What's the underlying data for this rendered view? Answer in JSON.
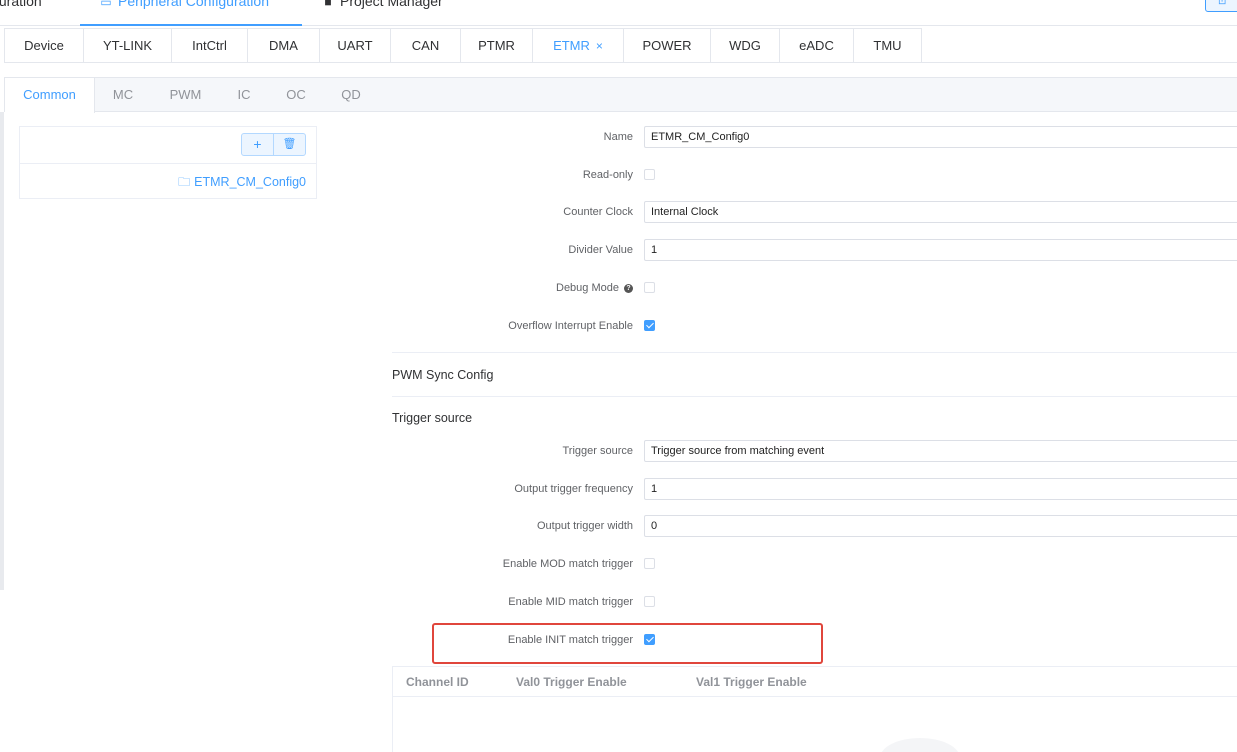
{
  "top_nav": {
    "tabs": [
      {
        "label": "iguration",
        "icon": ""
      },
      {
        "label": "Peripheral Configuration",
        "icon": "monitor-icon"
      },
      {
        "label": "Project Manager",
        "icon": "document-icon"
      }
    ],
    "active_tab": "Peripheral Configuration"
  },
  "peripheral_tabs": [
    {
      "label": "Device"
    },
    {
      "label": "YT-LINK"
    },
    {
      "label": "IntCtrl"
    },
    {
      "label": "DMA"
    },
    {
      "label": "UART"
    },
    {
      "label": "CAN"
    },
    {
      "label": "PTMR"
    },
    {
      "label": "ETMR",
      "active": true,
      "closable": true,
      "close_glyph": "×"
    },
    {
      "label": "POWER"
    },
    {
      "label": "WDG"
    },
    {
      "label": "eADC"
    },
    {
      "label": "TMU"
    }
  ],
  "sub_tabs": [
    {
      "label": "Common",
      "active": true
    },
    {
      "label": "MC"
    },
    {
      "label": "PWM"
    },
    {
      "label": "IC"
    },
    {
      "label": "OC"
    },
    {
      "label": "QD"
    }
  ],
  "config_list": {
    "add_glyph": "+",
    "delete_glyph": "🗑",
    "items": [
      {
        "label": "ETMR_CM_Config0",
        "icon": "folder-icon"
      }
    ]
  },
  "form": {
    "name": {
      "label": "Name",
      "value": "ETMR_CM_Config0"
    },
    "read_only": {
      "label": "Read-only",
      "checked": false
    },
    "counter_clock": {
      "label": "Counter Clock",
      "value": "Internal Clock"
    },
    "divider_value": {
      "label": "Divider Value",
      "value": "1"
    },
    "debug_mode": {
      "label": "Debug Mode",
      "checked": false,
      "help_glyph": "?"
    },
    "overflow_interrupt": {
      "label": "Overflow Interrupt Enable",
      "checked": true
    },
    "pwm_sync_title": "PWM Sync Config",
    "trigger_section_title": "Trigger source",
    "trigger_source": {
      "label": "Trigger source",
      "value": "Trigger source from matching event"
    },
    "output_trigger_frequency": {
      "label": "Output trigger frequency",
      "value": "1"
    },
    "output_trigger_width": {
      "label": "Output trigger width",
      "value": "0"
    },
    "mod_match": {
      "label": "Enable MOD match trigger",
      "checked": false
    },
    "mid_match": {
      "label": "Enable MID match trigger",
      "checked": false
    },
    "init_match": {
      "label": "Enable INIT match trigger",
      "checked": true
    }
  },
  "channel_table": {
    "columns": [
      "Channel ID",
      "Val0 Trigger Enable",
      "Val1 Trigger Enable"
    ]
  },
  "colors": {
    "accent": "#409eff",
    "highlight_border": "#e0463c"
  }
}
